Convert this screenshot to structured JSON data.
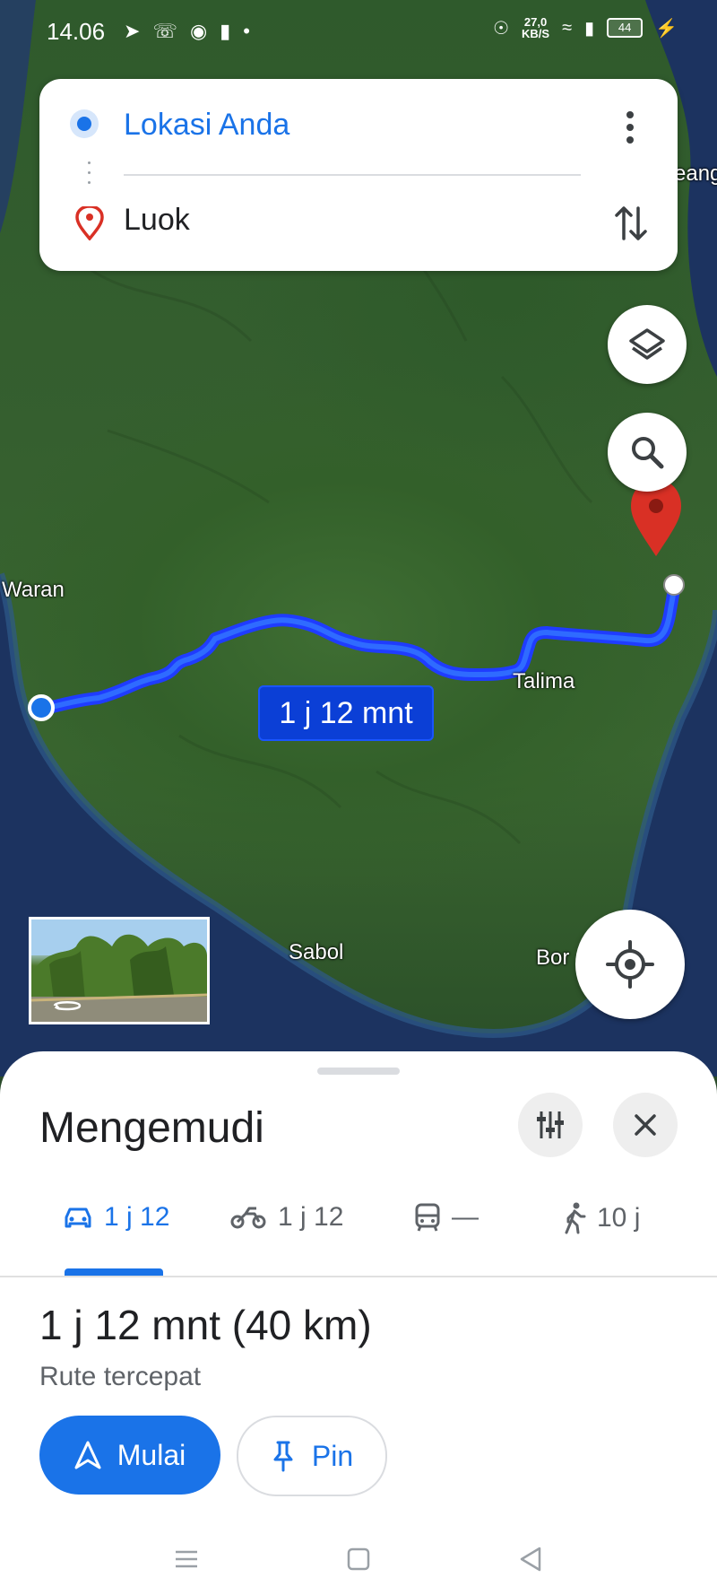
{
  "status_bar": {
    "time": "14.06",
    "net_speed_value": "27,0",
    "net_speed_unit": "KB/S",
    "battery": "44"
  },
  "route_card": {
    "origin": "Lokasi Anda",
    "destination": "Luok"
  },
  "map": {
    "labels": {
      "waran": "Waran",
      "talima": "Talima",
      "sabol": "Sabol",
      "bor": "Bor",
      "eang": "eang"
    },
    "duration_chip": "1 j 12 mnt"
  },
  "sheet": {
    "title": "Mengemudi",
    "modes": [
      {
        "icon": "car-icon",
        "label": "1 j 12"
      },
      {
        "icon": "motorcycle-icon",
        "label": "1 j 12"
      },
      {
        "icon": "transit-icon",
        "label": "—"
      },
      {
        "icon": "walk-icon",
        "label": "10 j"
      }
    ],
    "summary": "1 j 12 mnt (40 km)",
    "subtitle": "Rute tercepat",
    "start_label": "Mulai",
    "pin_label": "Pin"
  },
  "colors": {
    "accent": "#1a73e8",
    "route": "#1f3cff",
    "destination_pin": "#d93025"
  }
}
